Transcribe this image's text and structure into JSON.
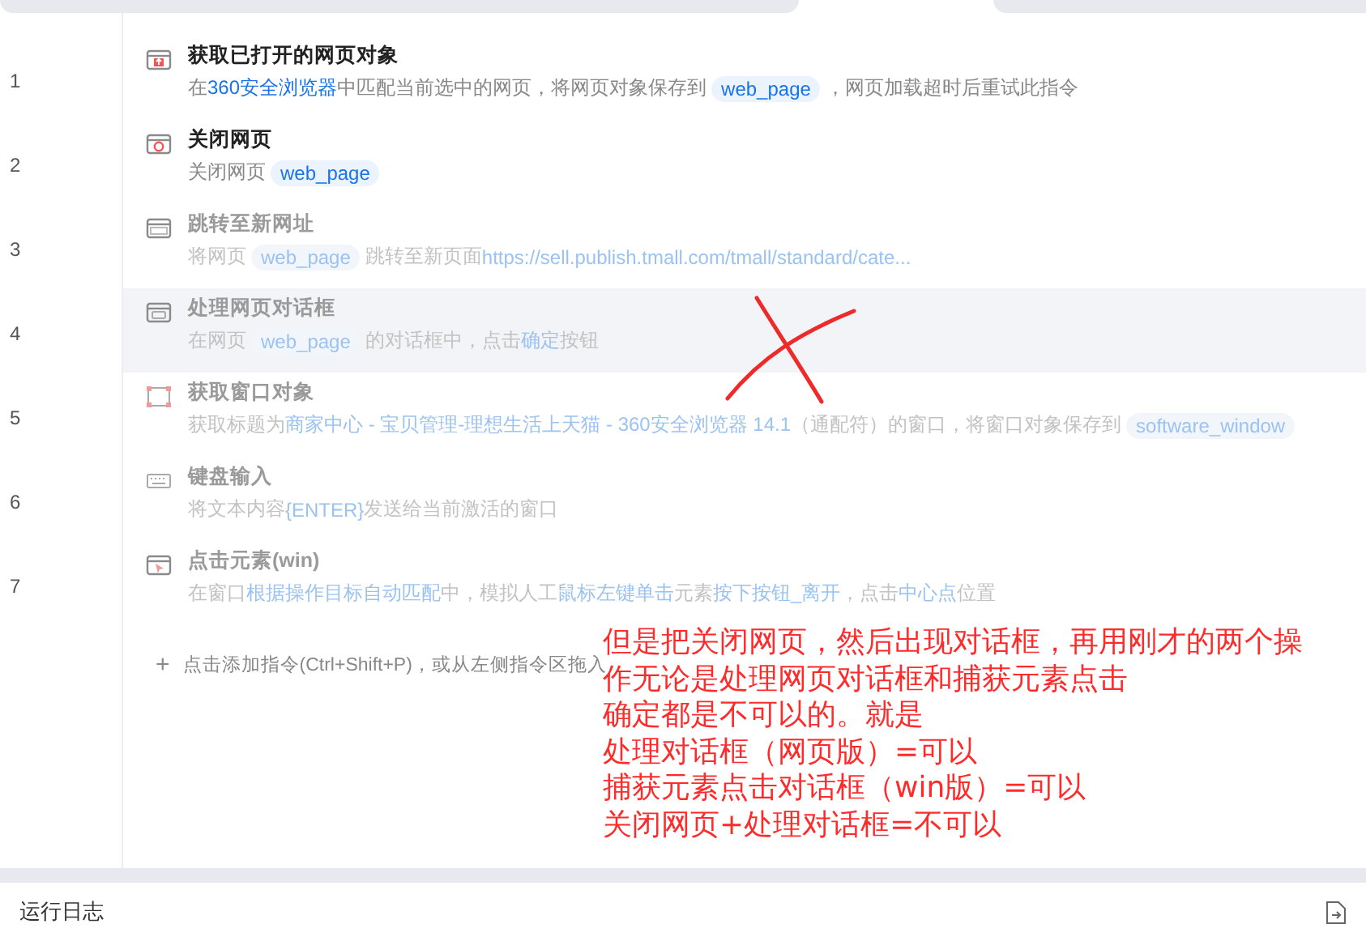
{
  "steps": [
    {
      "number": "1",
      "title": "获取已打开的网页对象",
      "kind": "browser-up",
      "enabled": true,
      "selected": false,
      "desc": [
        {
          "kind": "text",
          "text": "在"
        },
        {
          "kind": "link",
          "text": "360安全浏览器"
        },
        {
          "kind": "text",
          "text": "中匹配当前选中的网页，将网页对象保存到"
        },
        {
          "kind": "var",
          "text": "web_page"
        },
        {
          "kind": "text",
          "text": "，网页加载超时后重试此指令"
        }
      ]
    },
    {
      "number": "2",
      "title": "关闭网页",
      "kind": "browser-close",
      "enabled": true,
      "selected": false,
      "desc": [
        {
          "kind": "text",
          "text": "关闭网页"
        },
        {
          "kind": "var",
          "text": "web_page"
        }
      ]
    },
    {
      "number": "3",
      "title": "跳转至新网址",
      "kind": "browser",
      "enabled": false,
      "selected": false,
      "desc": [
        {
          "kind": "text",
          "text": "将网页"
        },
        {
          "kind": "var",
          "text": "web_page"
        },
        {
          "kind": "text",
          "text": "跳转至新页面"
        },
        {
          "kind": "link",
          "text": "https://sell.publish.tmall.com/tmall/standard/cate..."
        }
      ]
    },
    {
      "number": "4",
      "title": "处理网页对话框",
      "kind": "dialog",
      "enabled": false,
      "selected": true,
      "desc": [
        {
          "kind": "text",
          "text": "在网页"
        },
        {
          "kind": "var",
          "text": "web_page"
        },
        {
          "kind": "text",
          "text": "的对话框中，点击"
        },
        {
          "kind": "link",
          "text": "确定"
        },
        {
          "kind": "text",
          "text": "按钮"
        }
      ]
    },
    {
      "number": "5",
      "title": "获取窗口对象",
      "kind": "window",
      "enabled": false,
      "selected": false,
      "desc": [
        {
          "kind": "text",
          "text": "获取标题为"
        },
        {
          "kind": "link",
          "text": "商家中心 - 宝贝管理-理想生活上天猫 - 360安全浏览器 14.1"
        },
        {
          "kind": "text",
          "text": "（通配符）的窗口，将窗口对象保存到"
        },
        {
          "kind": "var",
          "text": "software_window"
        }
      ]
    },
    {
      "number": "6",
      "title": "键盘输入",
      "kind": "keyboard",
      "enabled": false,
      "selected": false,
      "desc": [
        {
          "kind": "text",
          "text": "将文本内容"
        },
        {
          "kind": "link",
          "text": "{ENTER}"
        },
        {
          "kind": "text",
          "text": "发送给当前激活的窗口"
        }
      ]
    },
    {
      "number": "7",
      "title": "点击元素(win)",
      "kind": "click",
      "enabled": false,
      "selected": false,
      "desc": [
        {
          "kind": "text",
          "text": "在窗口"
        },
        {
          "kind": "link",
          "text": "根据操作目标自动匹配"
        },
        {
          "kind": "text",
          "text": "中，模拟人工"
        },
        {
          "kind": "link",
          "text": "鼠标左键单击"
        },
        {
          "kind": "text",
          "text": "元素"
        },
        {
          "kind": "link",
          "text": "按下按钮_离开"
        },
        {
          "kind": "text",
          "text": "，点击"
        },
        {
          "kind": "link",
          "text": "中心点"
        },
        {
          "kind": "text",
          "text": "位置"
        }
      ]
    }
  ],
  "add_hint": {
    "icon": "+",
    "text": "点击添加指令(Ctrl+Shift+P)，或从左侧指令区拖入"
  },
  "annotation": {
    "lines": [
      "但是把关闭网页，然后出现对话框，再用刚才的两个操",
      "作无论是处理网页对话框和捕获元素点击",
      "确定都是不可以的。就是",
      "处理对话框（网页版）=可以",
      "捕获元素点击对话框（win版）=可以",
      "关闭网页+处理对话框=不可以"
    ]
  },
  "log_panel": {
    "title": "运行日志"
  }
}
